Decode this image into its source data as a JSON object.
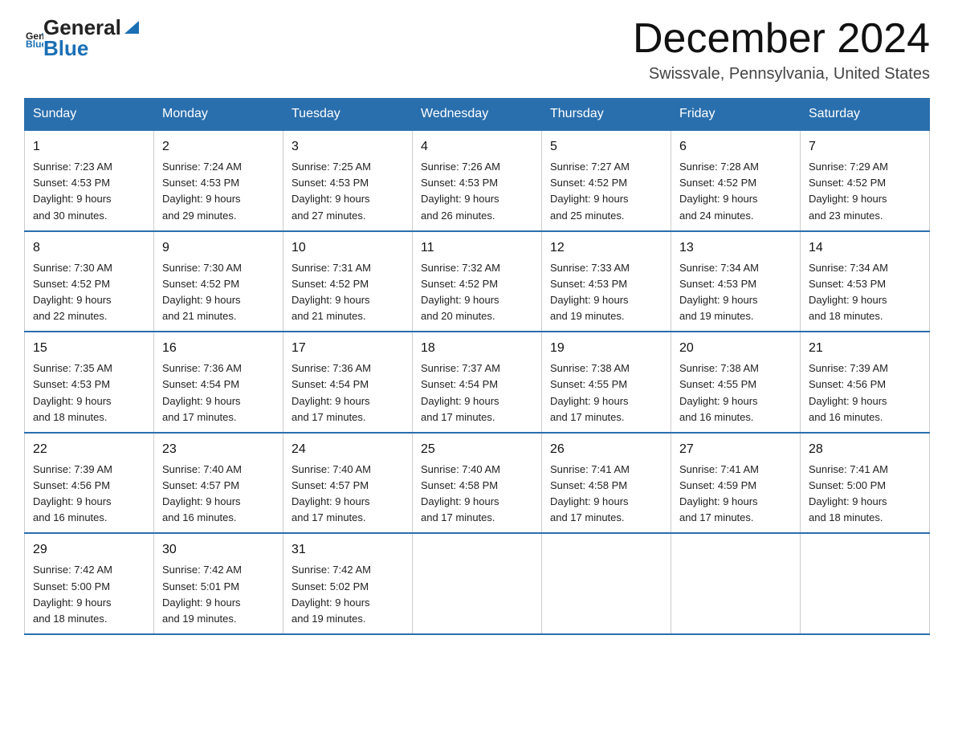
{
  "header": {
    "logo_general": "General",
    "logo_blue": "Blue",
    "month_title": "December 2024",
    "location": "Swissvale, Pennsylvania, United States"
  },
  "weekdays": [
    "Sunday",
    "Monday",
    "Tuesday",
    "Wednesday",
    "Thursday",
    "Friday",
    "Saturday"
  ],
  "weeks": [
    [
      {
        "day": "1",
        "sunrise": "7:23 AM",
        "sunset": "4:53 PM",
        "daylight": "9 hours and 30 minutes."
      },
      {
        "day": "2",
        "sunrise": "7:24 AM",
        "sunset": "4:53 PM",
        "daylight": "9 hours and 29 minutes."
      },
      {
        "day": "3",
        "sunrise": "7:25 AM",
        "sunset": "4:53 PM",
        "daylight": "9 hours and 27 minutes."
      },
      {
        "day": "4",
        "sunrise": "7:26 AM",
        "sunset": "4:53 PM",
        "daylight": "9 hours and 26 minutes."
      },
      {
        "day": "5",
        "sunrise": "7:27 AM",
        "sunset": "4:52 PM",
        "daylight": "9 hours and 25 minutes."
      },
      {
        "day": "6",
        "sunrise": "7:28 AM",
        "sunset": "4:52 PM",
        "daylight": "9 hours and 24 minutes."
      },
      {
        "day": "7",
        "sunrise": "7:29 AM",
        "sunset": "4:52 PM",
        "daylight": "9 hours and 23 minutes."
      }
    ],
    [
      {
        "day": "8",
        "sunrise": "7:30 AM",
        "sunset": "4:52 PM",
        "daylight": "9 hours and 22 minutes."
      },
      {
        "day": "9",
        "sunrise": "7:30 AM",
        "sunset": "4:52 PM",
        "daylight": "9 hours and 21 minutes."
      },
      {
        "day": "10",
        "sunrise": "7:31 AM",
        "sunset": "4:52 PM",
        "daylight": "9 hours and 21 minutes."
      },
      {
        "day": "11",
        "sunrise": "7:32 AM",
        "sunset": "4:52 PM",
        "daylight": "9 hours and 20 minutes."
      },
      {
        "day": "12",
        "sunrise": "7:33 AM",
        "sunset": "4:53 PM",
        "daylight": "9 hours and 19 minutes."
      },
      {
        "day": "13",
        "sunrise": "7:34 AM",
        "sunset": "4:53 PM",
        "daylight": "9 hours and 19 minutes."
      },
      {
        "day": "14",
        "sunrise": "7:34 AM",
        "sunset": "4:53 PM",
        "daylight": "9 hours and 18 minutes."
      }
    ],
    [
      {
        "day": "15",
        "sunrise": "7:35 AM",
        "sunset": "4:53 PM",
        "daylight": "9 hours and 18 minutes."
      },
      {
        "day": "16",
        "sunrise": "7:36 AM",
        "sunset": "4:54 PM",
        "daylight": "9 hours and 17 minutes."
      },
      {
        "day": "17",
        "sunrise": "7:36 AM",
        "sunset": "4:54 PM",
        "daylight": "9 hours and 17 minutes."
      },
      {
        "day": "18",
        "sunrise": "7:37 AM",
        "sunset": "4:54 PM",
        "daylight": "9 hours and 17 minutes."
      },
      {
        "day": "19",
        "sunrise": "7:38 AM",
        "sunset": "4:55 PM",
        "daylight": "9 hours and 17 minutes."
      },
      {
        "day": "20",
        "sunrise": "7:38 AM",
        "sunset": "4:55 PM",
        "daylight": "9 hours and 16 minutes."
      },
      {
        "day": "21",
        "sunrise": "7:39 AM",
        "sunset": "4:56 PM",
        "daylight": "9 hours and 16 minutes."
      }
    ],
    [
      {
        "day": "22",
        "sunrise": "7:39 AM",
        "sunset": "4:56 PM",
        "daylight": "9 hours and 16 minutes."
      },
      {
        "day": "23",
        "sunrise": "7:40 AM",
        "sunset": "4:57 PM",
        "daylight": "9 hours and 16 minutes."
      },
      {
        "day": "24",
        "sunrise": "7:40 AM",
        "sunset": "4:57 PM",
        "daylight": "9 hours and 17 minutes."
      },
      {
        "day": "25",
        "sunrise": "7:40 AM",
        "sunset": "4:58 PM",
        "daylight": "9 hours and 17 minutes."
      },
      {
        "day": "26",
        "sunrise": "7:41 AM",
        "sunset": "4:58 PM",
        "daylight": "9 hours and 17 minutes."
      },
      {
        "day": "27",
        "sunrise": "7:41 AM",
        "sunset": "4:59 PM",
        "daylight": "9 hours and 17 minutes."
      },
      {
        "day": "28",
        "sunrise": "7:41 AM",
        "sunset": "5:00 PM",
        "daylight": "9 hours and 18 minutes."
      }
    ],
    [
      {
        "day": "29",
        "sunrise": "7:42 AM",
        "sunset": "5:00 PM",
        "daylight": "9 hours and 18 minutes."
      },
      {
        "day": "30",
        "sunrise": "7:42 AM",
        "sunset": "5:01 PM",
        "daylight": "9 hours and 19 minutes."
      },
      {
        "day": "31",
        "sunrise": "7:42 AM",
        "sunset": "5:02 PM",
        "daylight": "9 hours and 19 minutes."
      },
      null,
      null,
      null,
      null
    ]
  ]
}
